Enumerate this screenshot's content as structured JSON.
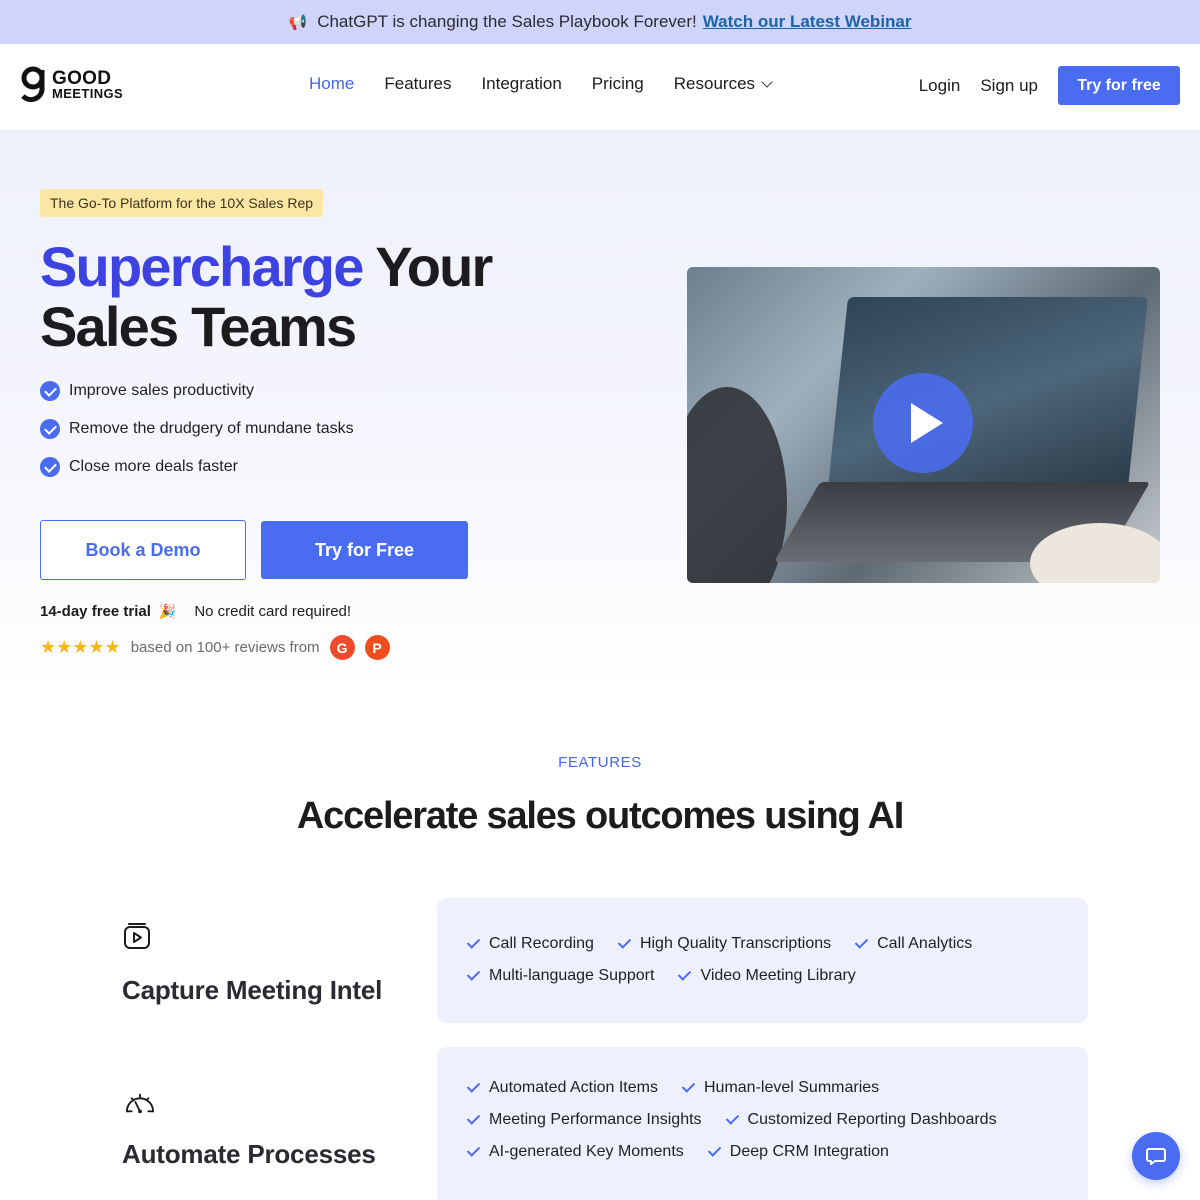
{
  "announcement": {
    "emoji": "📢",
    "text": "ChatGPT is changing the Sales Playbook Forever!",
    "link": "Watch our Latest Webinar"
  },
  "nav": {
    "logo_line1": "GOOD",
    "logo_line2": "MEETINGS",
    "items": [
      {
        "label": "Home",
        "active": true
      },
      {
        "label": "Features"
      },
      {
        "label": "Integration"
      },
      {
        "label": "Pricing"
      },
      {
        "label": "Resources",
        "dropdown": true
      }
    ],
    "login": "Login",
    "signup": "Sign up",
    "cta": "Try for free"
  },
  "hero": {
    "tag": "The Go-To Platform for the 10X Sales Rep",
    "headline_accent": "Supercharge",
    "headline_rest_1": "Your",
    "headline_rest_2": "Sales Teams",
    "bullets": [
      "Improve sales productivity",
      "Remove the drudgery of mundane tasks",
      "Close more deals faster"
    ],
    "demo_button": "Book a Demo",
    "free_button": "Try for Free",
    "trial_bold": "14-day free trial",
    "trial_emoji": "🎉",
    "trial_note": "No credit card required!",
    "stars": "★★★★★",
    "reviews_text": "based on 100+ reviews from",
    "badge_g2": "G",
    "badge_ph": "P"
  },
  "features": {
    "label": "FEATURES",
    "title": "Accelerate sales outcomes using AI",
    "rows": [
      {
        "title": "Capture Meeting Intel",
        "lines": [
          [
            "Call Recording",
            "High Quality Transcriptions",
            "Call Analytics"
          ],
          [
            "Multi-language Support",
            "Video Meeting Library"
          ]
        ]
      },
      {
        "title": "Automate Processes",
        "lines": [
          [
            "Automated Action Items",
            "Human-level Summaries"
          ],
          [
            "Meeting Performance Insights",
            "Customized Reporting Dashboards"
          ],
          [
            "AI-generated Key Moments",
            "Deep CRM Integration"
          ]
        ]
      }
    ]
  },
  "colors": {
    "brand": "#4a6cf0",
    "accent_headline": "#3d43e0",
    "announce_bg": "#cfd4fb",
    "tag_bg": "#fbe7a4",
    "card_bg": "#eef1fd"
  }
}
